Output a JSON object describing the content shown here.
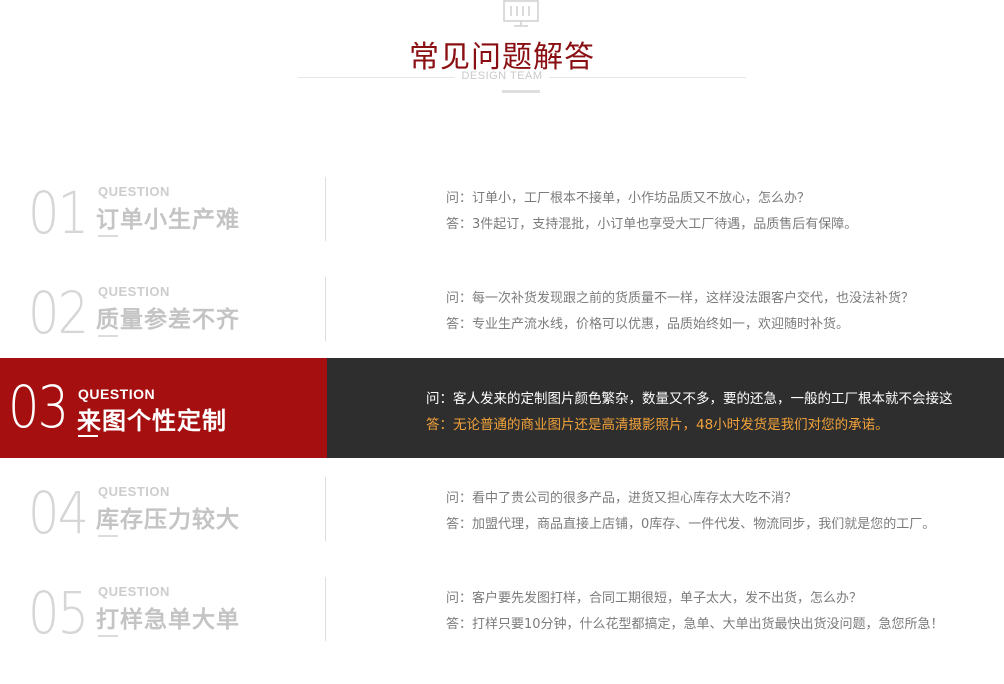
{
  "header": {
    "title": "常见问题解答",
    "subtitle": "DESIGN TEAM",
    "icon": "monitor-icon"
  },
  "faq": [
    {
      "number": "01",
      "label": "QUESTION",
      "topic": "订单小生产难",
      "question": "问：订单小，工厂根本不接单，小作坊品质又不放心，怎么办？",
      "answer": "答：3件起订，支持混批，小订单也享受大工厂待遇，品质售后有保障。"
    },
    {
      "number": "02",
      "label": "QUESTION",
      "topic": "质量参差不齐",
      "question": "问：每一次补货发现跟之前的货质量不一样，这样没法跟客户交代，也没法补货？",
      "answer": "答：专业生产流水线，价格可以优惠，品质始终如一，欢迎随时补货。"
    },
    {
      "number": "03",
      "label": "QUESTION",
      "topic": "来图个性定制",
      "question": "问：客人发来的定制图片颜色繁杂，数量又不多，要的还急，一般的工厂根本就不会接这",
      "answer": "答：无论普通的商业图片还是高清摄影照片，48小时发货是我们对您的承诺。"
    },
    {
      "number": "04",
      "label": "QUESTION",
      "topic": "库存压力较大",
      "question": "问：看中了贵公司的很多产品，进货又担心库存太大吃不消？",
      "answer": "答：加盟代理，商品直接上店铺，0库存、一件代发、物流同步，我们就是您的工厂。"
    },
    {
      "number": "05",
      "label": "QUESTION",
      "topic": "打样急单大单",
      "question": "问：客户要先发图打样，合同工期很短，单子太大，发不出货，怎么办？",
      "answer": "答：打样只要10分钟，什么花型都搞定，急单、大单出货最快出货没问题，急您所急！"
    }
  ],
  "colors": {
    "title": "#8a0f12",
    "active_left": "#a50f0f",
    "active_right": "#2e2e2e",
    "active_answer": "#f2a23a"
  }
}
